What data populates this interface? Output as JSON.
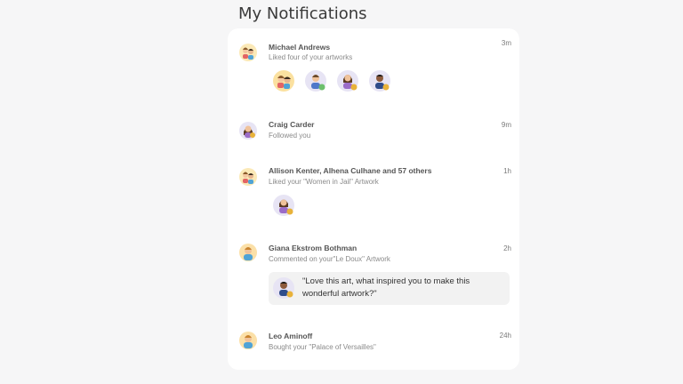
{
  "page": {
    "title": "My Notifications"
  },
  "notifications": [
    {
      "name": "Michael Andrews",
      "description": "Liked four of your artworks",
      "time": "3m"
    },
    {
      "name": "Craig Carder",
      "description": "Followed you",
      "time": "9m"
    },
    {
      "name": "Allison Kenter, Alhena Culhane and 57 others",
      "description": "Liked your \"Women in Jail\" Artwork",
      "time": "1h"
    },
    {
      "name": "Giana Ekstrom Bothman",
      "description": "Commented on your\"Le Doux\" Artwork",
      "time": "2h",
      "comment": "\"Love this art, what inspired you to make this wonderful artwork?\""
    },
    {
      "name": "Leo Aminoff",
      "description": "Bought your \"Palace of Versailles\"",
      "time": "24h"
    }
  ],
  "colors": {
    "background": "#f6f6f7",
    "card": "#ffffff",
    "accent_gold": "#e8b23a",
    "accent_purple": "#c9c2e8"
  },
  "icons": [
    "couple-avatar-icon",
    "man-avatar-icon",
    "woman-avatar-icon",
    "badge-icon"
  ]
}
